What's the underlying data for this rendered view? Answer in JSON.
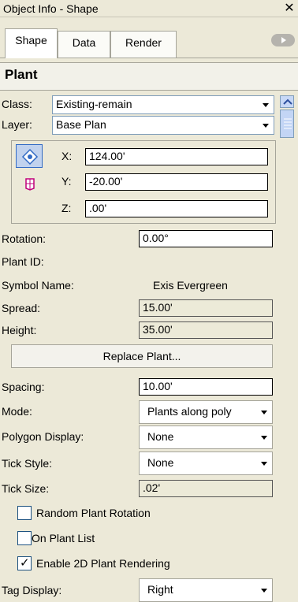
{
  "window": {
    "title": "Object Info - Shape",
    "close_glyph": "✕"
  },
  "tabs": [
    {
      "label": "Shape",
      "active": true
    },
    {
      "label": "Data",
      "active": false
    },
    {
      "label": "Render",
      "active": false
    }
  ],
  "object_name": "Plant",
  "class": {
    "label": "Class:",
    "value": "Existing-remain"
  },
  "layer": {
    "label": "Layer:",
    "value": "Base Plan"
  },
  "coords": {
    "x_label": "X:",
    "x_value": "124.00'",
    "y_label": "Y:",
    "y_value": "-20.00'",
    "z_label": "Z:",
    "z_value": ".00'"
  },
  "fields": {
    "rotation": {
      "label": "Rotation:",
      "value": "0.00°"
    },
    "plant_id": {
      "label": "Plant ID:"
    },
    "symbol_name": {
      "label": "Symbol Name:",
      "value": "Exis Evergreen"
    },
    "spread": {
      "label": "Spread:",
      "value": "15.00'"
    },
    "height": {
      "label": "Height:",
      "value": "35.00'"
    },
    "replace_button": "Replace Plant...",
    "spacing": {
      "label": "Spacing:",
      "value": "10.00'"
    },
    "mode": {
      "label": "Mode:",
      "value": "Plants along poly"
    },
    "polygon_display": {
      "label": "Polygon Display:",
      "value": "None"
    },
    "tick_style": {
      "label": "Tick Style:",
      "value": "None"
    },
    "tick_size": {
      "label": "Tick Size:",
      "value": ".02'"
    },
    "random_rotation": {
      "label": "Random Plant Rotation",
      "checked": false
    },
    "on_plant_list": {
      "label": "On Plant List",
      "checked": false
    },
    "enable_2d": {
      "label": "Enable 2D Plant Rendering",
      "checked": true
    },
    "tag_display": {
      "label": "Tag Display:",
      "value": "Right"
    }
  }
}
